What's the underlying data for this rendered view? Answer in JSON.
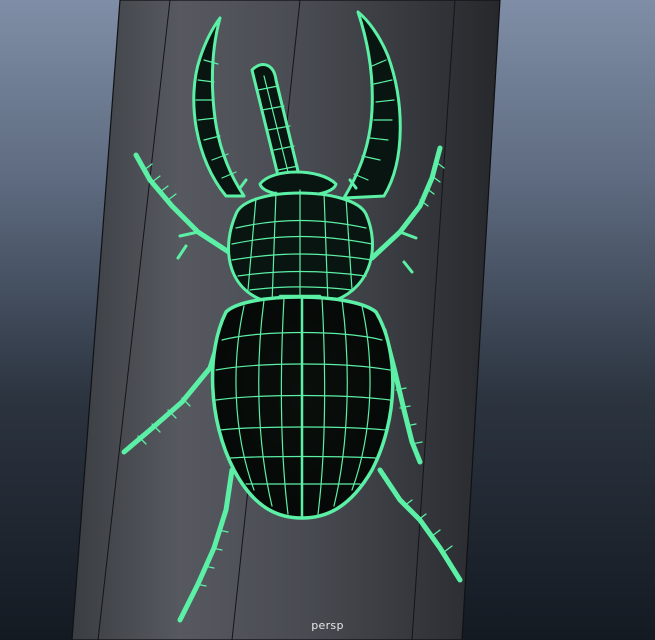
{
  "viewport": {
    "camera_label": "persp",
    "background_top": "#7f8ea6",
    "background_bottom": "#141a22",
    "wireframe_color": "#5cf0a6",
    "wireframe_dark": "#0b1a12",
    "surface_color": "#3b3e44",
    "edge_color": "#101114"
  },
  "scene": {
    "objects": [
      {
        "name": "cylinder-backdrop"
      },
      {
        "name": "hercules-beetle-model",
        "display": "wireframe-on-shaded"
      }
    ]
  }
}
